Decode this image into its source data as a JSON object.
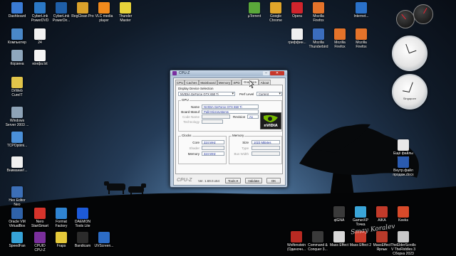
{
  "desktop": {
    "icons_left": [
      {
        "label": "Dashboard",
        "color": "#3a7bd5"
      },
      {
        "label": "CyberLink\nPowerDVD",
        "color": "#2b78c5"
      },
      {
        "label": "CyberLink\nPowerDir...",
        "color": "#1f5fa8"
      },
      {
        "label": "RegClean Pro",
        "color": "#d9a12b"
      },
      {
        "label": "VLC media\nplayer",
        "color": "#f08a1c"
      },
      {
        "label": "Thunder\nMaster",
        "color": "#e6d23a"
      },
      {
        "label": "Компьютер",
        "color": "#4a88c8"
      },
      {
        "label": "24",
        "color": "#f2f2f2"
      },
      {
        "label": "Корзина",
        "color": "#8fa7bd"
      },
      {
        "label": "конфа.txt",
        "color": "#f5f5f5"
      },
      {
        "label": "DrWeb\nCureIT",
        "color": "#e2c54a"
      },
      {
        "label": "Windows\nServer 2003 ...",
        "color": "#8ea3b7"
      },
      {
        "label": "TCPOptimi...",
        "color": "#4b90d8"
      },
      {
        "label": "Внимание!...",
        "color": "#f0f0f0"
      },
      {
        "label": "Hex Editor\nNeo",
        "color": "#3c6fb7"
      },
      {
        "label": "Oracle VM\nVirtualBox",
        "color": "#2f62a8"
      },
      {
        "label": "Nero\nStartSmart",
        "color": "#d6332b"
      },
      {
        "label": "Format\nFactory",
        "color": "#2f84d2"
      },
      {
        "label": "DAEMON\nTools Lite",
        "color": "#1d5ad8"
      },
      {
        "label": "SpeedFan",
        "color": "#36a3d8"
      },
      {
        "label": "CPUID\nCPU-Z",
        "color": "#7a2f9c"
      },
      {
        "label": "Fraps",
        "color": "#e5c93a"
      },
      {
        "label": "Bandicam",
        "color": "#2b2b2b"
      },
      {
        "label": "UVScreen...",
        "color": "#2c6cc6"
      }
    ],
    "icons_right": [
      {
        "label": "µTorrent",
        "color": "#5aa83a"
      },
      {
        "label": "Google\nChrome",
        "color": "#e0a52a"
      },
      {
        "label": "Opera",
        "color": "#d0242c"
      },
      {
        "label": "Mozilla\nFirefox",
        "color": "#e4732a"
      },
      {
        "label": "Internet...",
        "color": "#2a71c9"
      },
      {
        "label": "гриффин...",
        "color": "#f0f0f0"
      },
      {
        "label": "Mozilla\nThunderbird",
        "color": "#3b6dbd"
      },
      {
        "label": "Mozilla\nFirefox",
        "color": "#e4732a"
      },
      {
        "label": "Mozilla\nFirefox",
        "color": "#e4732a"
      },
      {
        "label": "Ещё файлы\nмусора",
        "color": "#e8e8e8"
      },
      {
        "label": "Внутр.файл\nпродаж.docx",
        "color": "#2a5bb0"
      },
      {
        "label": "qlGNA",
        "color": "#3a3a3a"
      },
      {
        "label": "GamerXP\nТочка",
        "color": "#3aa5d8"
      },
      {
        "label": "AIKA",
        "color": "#c23a2a"
      },
      {
        "label": "Keeks",
        "color": "#d84a2a"
      },
      {
        "label": "Wolfenstein\n(Одиночн...",
        "color": "#b82a22"
      },
      {
        "label": "Command &\nConquer 3...",
        "color": "#3a3a3a"
      },
      {
        "label": "Mass Effect",
        "color": "#d8d8d8"
      },
      {
        "label": "Mass Effect 2",
        "color": "#c83a2a"
      },
      {
        "label": "MassEffect\nЯрлык",
        "color": "#b83a2a"
      },
      {
        "label": "TheElderScrolls\nV TheRiddles 3\nСборка 2023",
        "color": "#c8c8c8"
      }
    ],
    "signature": "Smay Koralev"
  },
  "cpuz": {
    "title": "CPU-Z",
    "window_controls": {
      "minimize": "–",
      "close": "✕"
    },
    "tabs": [
      "CPU",
      "Caches",
      "Mainboard",
      "Memory",
      "SPD",
      "Graphics",
      "About"
    ],
    "active_tab": "Graphics",
    "display_selection": {
      "label": "Display Device Selection",
      "device": "NVIDIA GeForce GTX 650 Ti",
      "perf_label": "Perf Level",
      "perf_value": "Current"
    },
    "gpu": {
      "group_label": "GPU",
      "name_label": "Name",
      "name_value": "NVIDIA GeForce GTX 650 Ti",
      "board_label": "Board Manuf",
      "board_value": "Palit Microsystems",
      "code_label": "Code Name",
      "code_value": "",
      "revision_label": "Revision",
      "revision_value": "A1",
      "tech_label": "Technology",
      "tech_value": "",
      "logo_text": "nVIDIA"
    },
    "clocks": {
      "group_label": "Clocks",
      "core_label": "Core",
      "core_value": "324 MHz",
      "shader_label": "Shader",
      "shader_value": "",
      "memory_label": "Memory",
      "memory_value": "324 MHz"
    },
    "memory": {
      "group_label": "Memory",
      "size_label": "Size",
      "size_value": "1023 MBytes",
      "type_label": "Type",
      "type_value": "",
      "bus_label": "Bus Width",
      "bus_value": ""
    },
    "footer": {
      "brand": "CPU-Z",
      "version": "Ver. 1.69.0.x64",
      "tools_label": "Tools",
      "validate_label": "Validate",
      "ok_label": "OK"
    }
  },
  "gadgets": {
    "clock1_city": "",
    "clock2_city": "Singapore"
  }
}
